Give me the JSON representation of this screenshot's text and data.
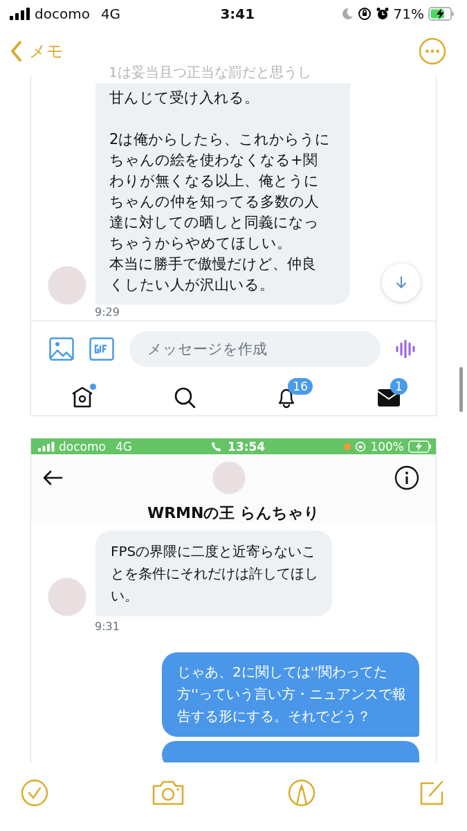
{
  "status_bar": {
    "carrier": "docomo",
    "network": "4G",
    "time": "3:41",
    "battery": "71%",
    "charging": true
  },
  "nav": {
    "back_label": "メモ"
  },
  "screenshot_1": {
    "faded_text": "1は妥当且つ正当な罰だと思うし",
    "message": {
      "paragraphs": [
        [
          "甘んじて受け入れる。"
        ],
        [
          "2は俺からしたら、これからうにちゃんの絵を使わなくなる+関わりが無くなる以上、俺とうにちゃんの仲を知ってる多数の人達に対しての晒しと同義になっちゃうからやめてほしい。",
          "本当に勝手で傲慢だけど、仲良くしたい人が沢山いる。"
        ]
      ],
      "time": "9:29"
    },
    "composer": {
      "placeholder": "メッセージを作成"
    },
    "tabs": [
      {
        "kind": "home",
        "dot": true
      },
      {
        "kind": "search"
      },
      {
        "kind": "notifications",
        "badge": "16"
      },
      {
        "kind": "messages",
        "badge": "1"
      }
    ]
  },
  "screenshot_2": {
    "status_bar": {
      "carrier": "docomo",
      "network": "4G",
      "time": "13:54",
      "battery": "100%",
      "in_call": true
    },
    "title": "WRMNの王 らんちゃり",
    "messages": [
      {
        "kind": "received",
        "text": "FPSの界隈に二度と近寄らないことを条件にそれだけは許してほしい。",
        "time": "9:31"
      },
      {
        "kind": "sent",
        "text": "じゃあ、2に関しては''関わってた方''っていう言い方・ニュアンスで報告する形にする。それでどう？"
      },
      {
        "kind": "sent_hidden"
      }
    ]
  }
}
